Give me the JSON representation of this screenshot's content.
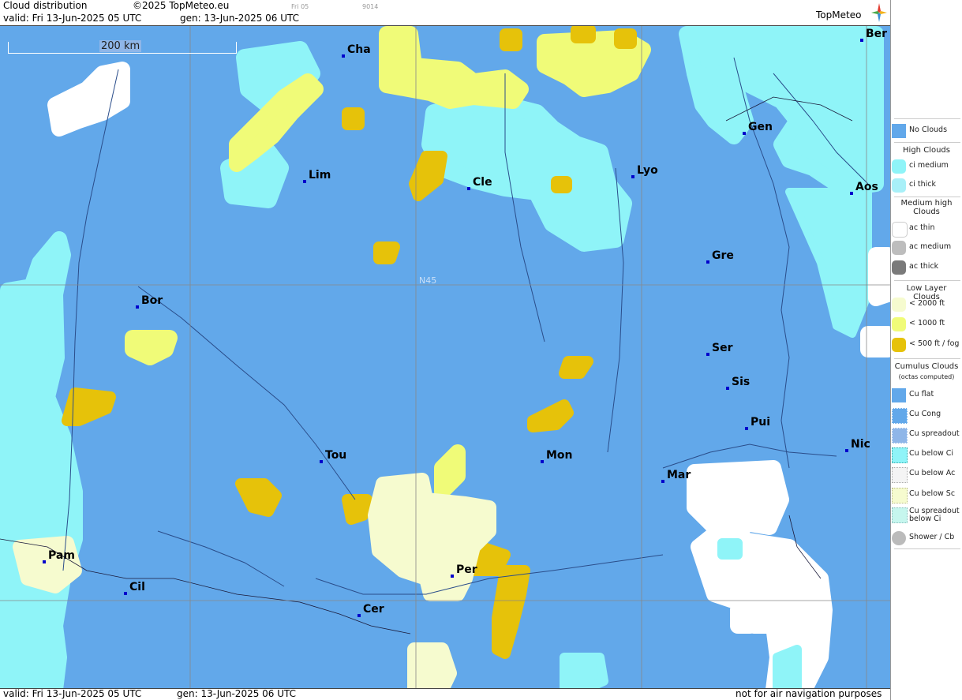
{
  "header": {
    "title": "Cloud distribution",
    "copyright": "©2025 TopMeteo.eu",
    "small_tag": "Fri 05",
    "small_code": "9014",
    "valid": "valid:  Fri  13-Jun-2025  05 UTC",
    "gen": "gen: 13-Jun-2025 06 UTC",
    "brand": "TopMeteo"
  },
  "map": {
    "scale_label": "200 km",
    "lat_label": "N45",
    "cities": [
      {
        "name": "Cha"
      },
      {
        "name": "Ber"
      },
      {
        "name": "Gen"
      },
      {
        "name": "Lim"
      },
      {
        "name": "Cle"
      },
      {
        "name": "Lyo"
      },
      {
        "name": "Aos"
      },
      {
        "name": "Gre"
      },
      {
        "name": "Bor"
      },
      {
        "name": "Ser"
      },
      {
        "name": "Sis"
      },
      {
        "name": "Pui"
      },
      {
        "name": "Tou"
      },
      {
        "name": "Mon"
      },
      {
        "name": "Nic"
      },
      {
        "name": "Mar"
      },
      {
        "name": "Pam"
      },
      {
        "name": "Per"
      },
      {
        "name": "Cil"
      },
      {
        "name": "Cer"
      }
    ]
  },
  "footer": {
    "valid": "valid:  Fri  13-Jun-2025  05 UTC",
    "gen": "gen: 13-Jun-2025 06 UTC",
    "notice": "not for air navigation purposes"
  },
  "legend": {
    "no_clouds": "No Clouds",
    "high_title": "High Clouds",
    "ci_medium": "ci medium",
    "ci_thick": "ci thick",
    "medium_title": "Medium high Clouds",
    "ac_thin": "ac thin",
    "ac_medium": "ac medium",
    "ac_thick": "ac thick",
    "low_title": "Low Layer Clouds",
    "low_2000": "< 2000 ft",
    "low_1000": "< 1000 ft",
    "low_500": "< 500 ft / fog",
    "cu_title": "Cumulus Clouds",
    "cu_sub": "(octas computed)",
    "cu_flat": "Cu flat",
    "cu_cong": "Cu Cong",
    "cu_spread": "Cu spreadout",
    "cu_below_ci": "Cu below Ci",
    "cu_below_ac": "Cu below Ac",
    "cu_below_sc": "Cu below Sc",
    "cu_spread_ci": "Cu spreadout below Ci",
    "shower": "Shower / Cb"
  },
  "colors": {
    "no_clouds": "#62a8ea",
    "ci_medium": "#8ff4f8",
    "ci_thick": "#a8f0f8",
    "ac_thin": "#ffffff",
    "low_2000": "#f6fbcf",
    "low_1000": "#f0fb78",
    "low_500": "#e6c20a"
  }
}
